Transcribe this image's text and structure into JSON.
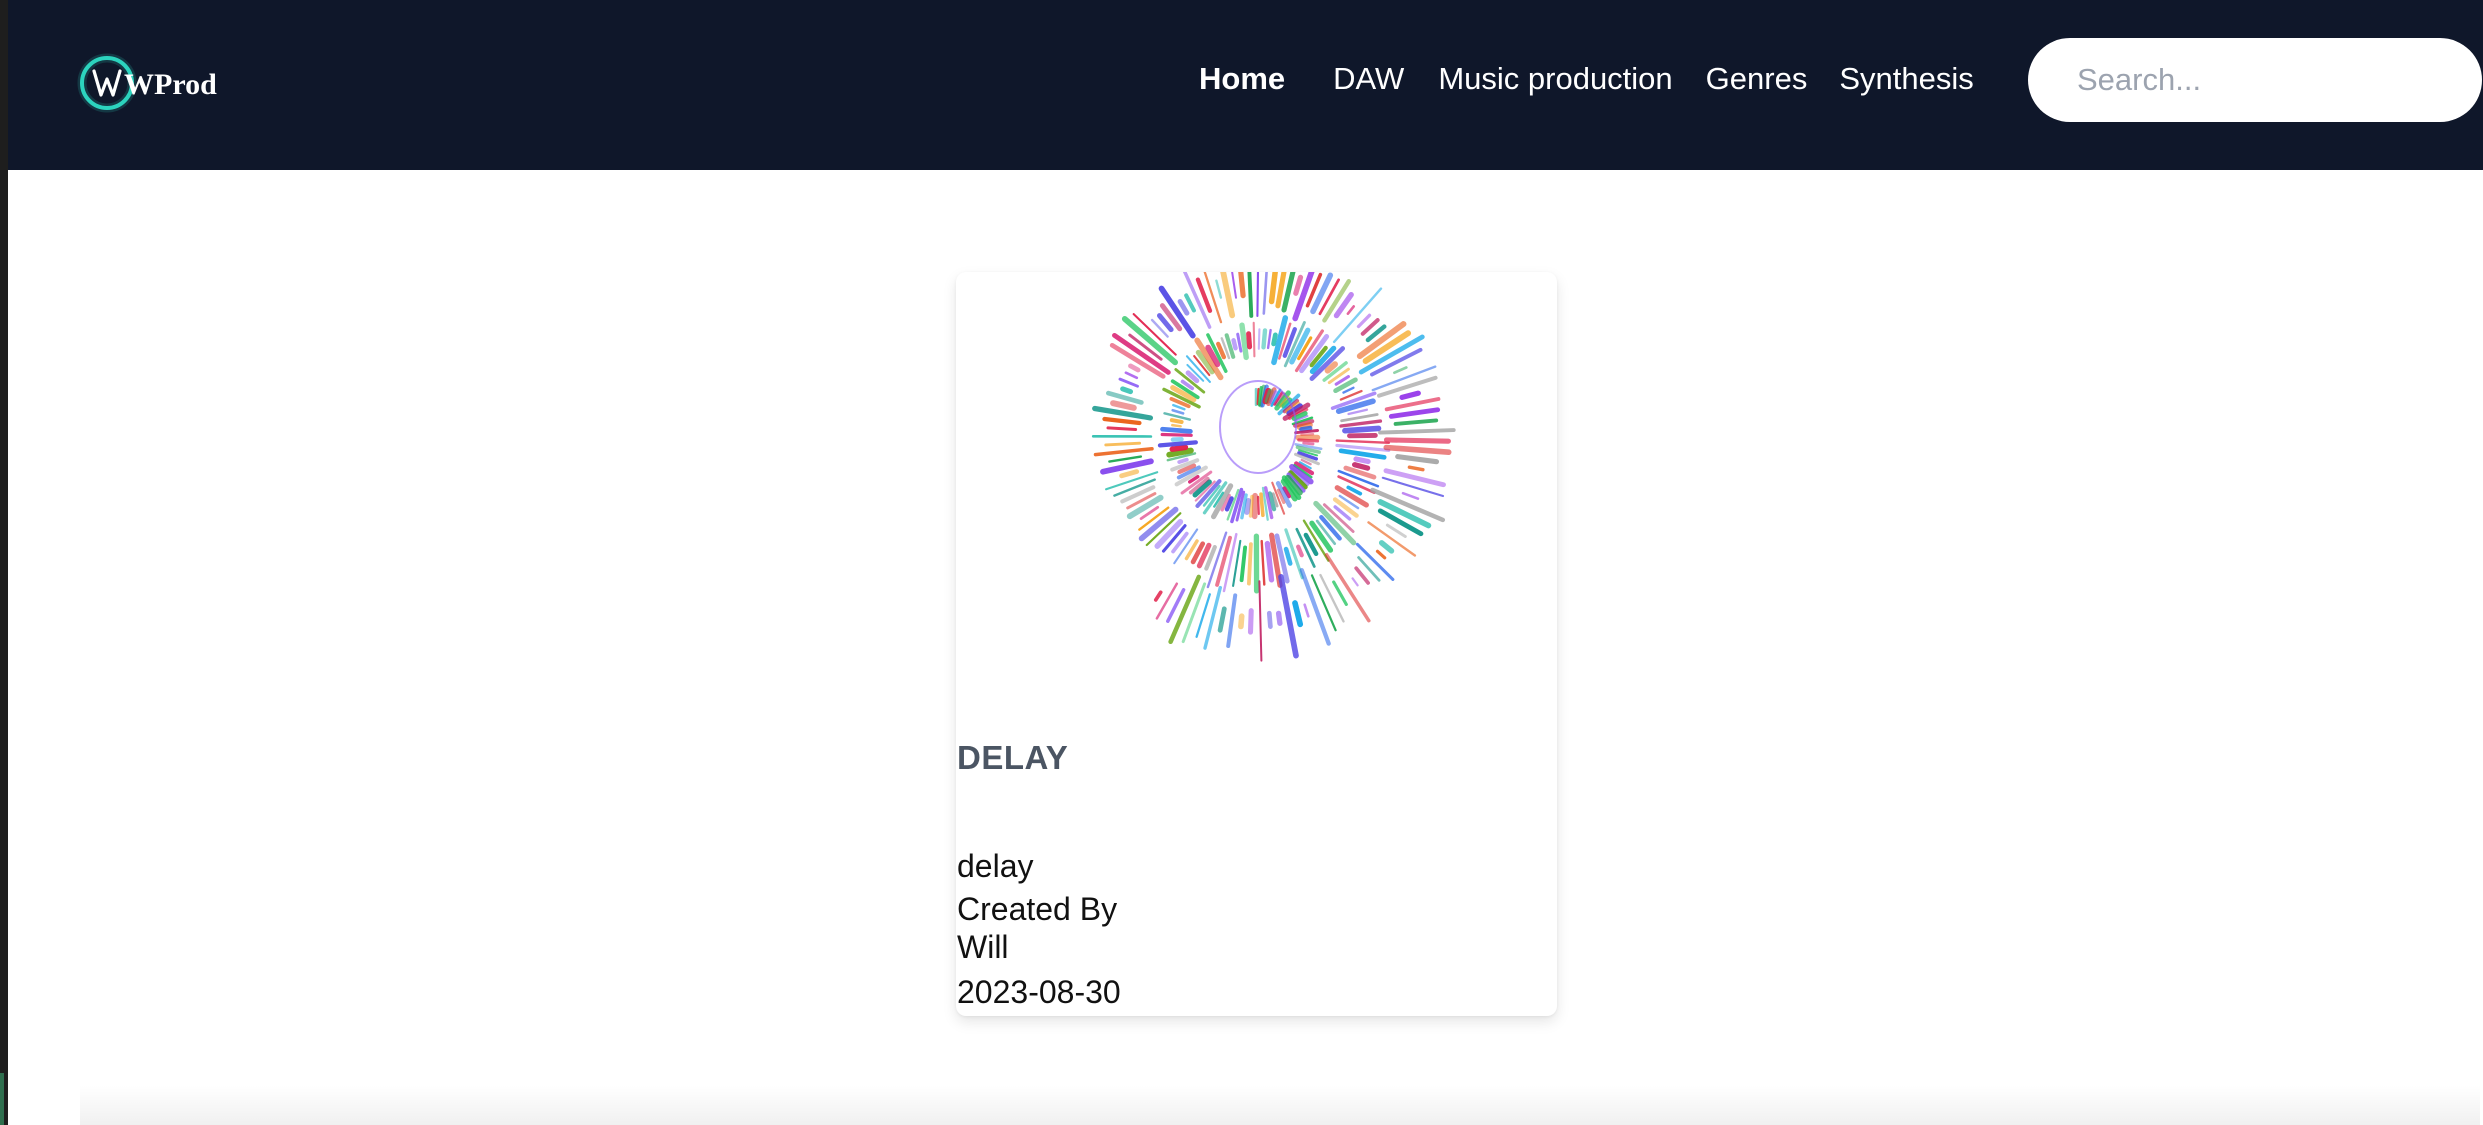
{
  "header": {
    "logo_text": "WProd",
    "nav": [
      {
        "label": "Home",
        "active": true
      },
      {
        "label": "DAW",
        "active": false
      },
      {
        "label": "Music production",
        "active": false
      },
      {
        "label": "Genres",
        "active": false
      },
      {
        "label": "Synthesis",
        "active": false
      }
    ],
    "search": {
      "placeholder": "Search...",
      "value": ""
    }
  },
  "card": {
    "title": "DELAY",
    "description": "delay",
    "created_by_label": "Created By",
    "author": "Will",
    "date": "2023-08-30"
  },
  "colors": {
    "navbar_bg": "#0f172a",
    "logo_accent": "#2dd4bf",
    "title_color": "#4b5563"
  }
}
